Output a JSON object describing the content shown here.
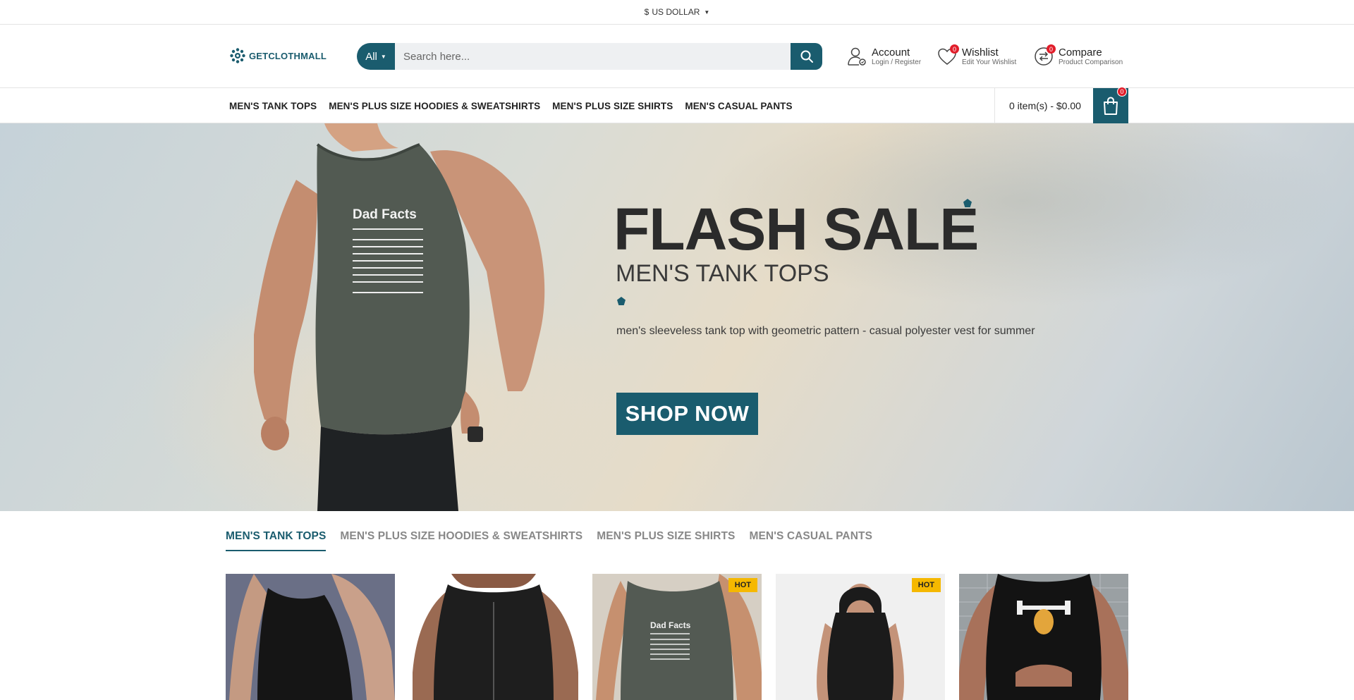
{
  "topbar": {
    "currency_symbol": "$",
    "currency_label": "US DOLLAR"
  },
  "header": {
    "logo_text": "GETCLOTHMALL",
    "search": {
      "category": "All",
      "placeholder": "Search here..."
    },
    "account": {
      "title": "Account",
      "subtitle": "Login / Register"
    },
    "wishlist": {
      "title": "Wishlist",
      "subtitle": "Edit Your Wishlist",
      "count": "0"
    },
    "compare": {
      "title": "Compare",
      "subtitle": "Product Comparison",
      "count": "0"
    }
  },
  "nav": {
    "items": [
      {
        "label": "MEN'S TANK TOPS"
      },
      {
        "label": "MEN'S PLUS SIZE HOODIES & SWEATSHIRTS"
      },
      {
        "label": "MEN'S PLUS SIZE SHIRTS"
      },
      {
        "label": "MEN'S CASUAL PANTS"
      }
    ],
    "cart": {
      "summary": "0 item(s) - $0.00",
      "count": "0"
    }
  },
  "hero": {
    "title": "FLASH SALE",
    "subtitle": "MEN'S TANK TOPS",
    "description": "men's sleeveless tank top with geometric pattern - casual polyester vest for summer",
    "cta": "SHOP NOW",
    "shirt_print_title": "Dad Facts"
  },
  "tabs": [
    {
      "label": "MEN'S TANK TOPS",
      "active": true
    },
    {
      "label": "MEN'S PLUS SIZE HOODIES & SWEATSHIRTS"
    },
    {
      "label": "MEN'S PLUS SIZE SHIRTS"
    },
    {
      "label": "MEN'S CASUAL PANTS"
    }
  ],
  "products": [
    {
      "image": "black fitted tank top on model",
      "badge": ""
    },
    {
      "image": "black zip-front tank vest on model",
      "badge": ""
    },
    {
      "image": "grey Dad Facts tank top on model",
      "badge": "HOT",
      "print_title": "Dad Facts"
    },
    {
      "image": "black sleeveless hooded tank on model",
      "badge": "HOT"
    },
    {
      "image": "black tank with dumbbell graphic on model",
      "badge": ""
    }
  ],
  "colors": {
    "brand": "#1a5c6e",
    "badge_red": "#e11d2a",
    "hot_badge": "#f5b800"
  }
}
